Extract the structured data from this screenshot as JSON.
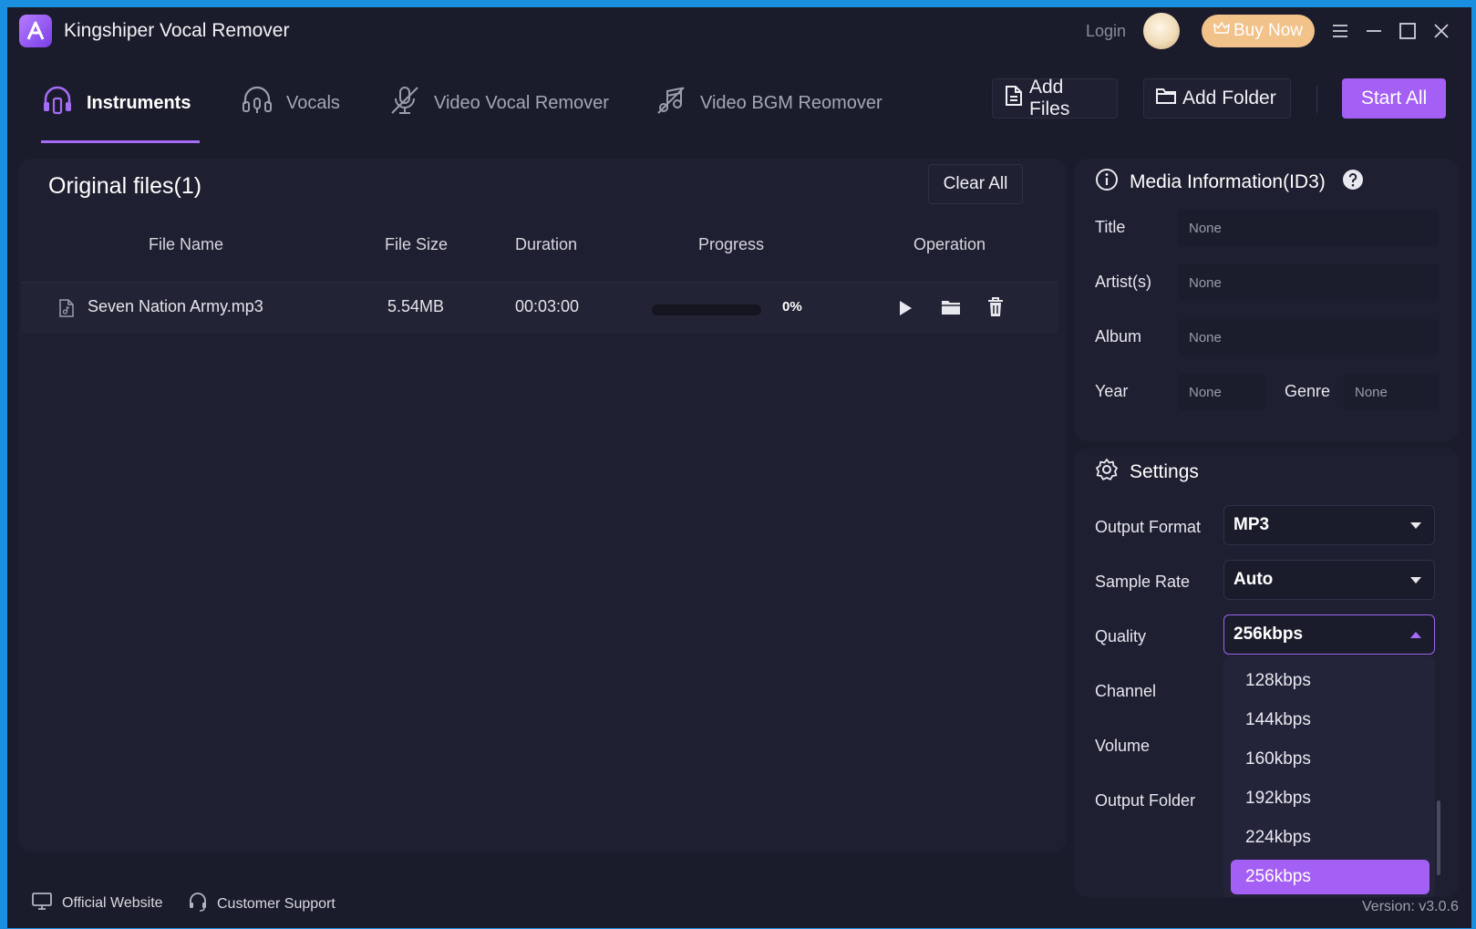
{
  "app": {
    "title": "Kingshiper Vocal Remover",
    "login": "Login",
    "buy_now": "Buy Now",
    "version": "Version: v3.0.6"
  },
  "tabs": [
    {
      "label": "Instruments",
      "icon": "headphones-icon",
      "active": true
    },
    {
      "label": "Vocals",
      "icon": "headset-mic-icon",
      "active": false
    },
    {
      "label": "Video Vocal Remover",
      "icon": "mic-off-icon",
      "active": false
    },
    {
      "label": "Video BGM Reomover",
      "icon": "music-off-icon",
      "active": false
    }
  ],
  "toolbar": {
    "add_files": "Add Files",
    "add_folder": "Add Folder",
    "start_all": "Start All"
  },
  "files": {
    "title": "Original files(1)",
    "clear_all": "Clear All",
    "columns": [
      "File Name",
      "File Size",
      "Duration",
      "Progress",
      "Operation"
    ],
    "rows": [
      {
        "name": "Seven Nation Army.mp3",
        "size": "5.54MB",
        "duration": "00:03:00",
        "progress": 0,
        "progress_label": "0%"
      }
    ]
  },
  "media": {
    "title": "Media Information(ID3)",
    "title_label": "Title",
    "title_value": "None",
    "artist_label": "Artist(s)",
    "artist_value": "None",
    "album_label": "Album",
    "album_value": "None",
    "year_label": "Year",
    "year_value": "None",
    "genre_label": "Genre",
    "genre_value": "None"
  },
  "settings": {
    "title": "Settings",
    "output_format_label": "Output Format",
    "output_format": "MP3",
    "sample_rate_label": "Sample Rate",
    "sample_rate": "Auto",
    "quality_label": "Quality",
    "quality": "256kbps",
    "channel_label": "Channel",
    "volume_label": "Volume",
    "output_folder_label": "Output Folder",
    "quality_options": [
      "128kbps",
      "144kbps",
      "160kbps",
      "192kbps",
      "224kbps",
      "256kbps"
    ]
  },
  "footer": {
    "website": "Official Website",
    "support": "Customer Support"
  },
  "colors": {
    "accent": "#a45ff5",
    "background": "#1b1c2b",
    "panel": "#1e1f30",
    "buy_now": "#f1c28a",
    "window_border": "#1a8fe0"
  }
}
